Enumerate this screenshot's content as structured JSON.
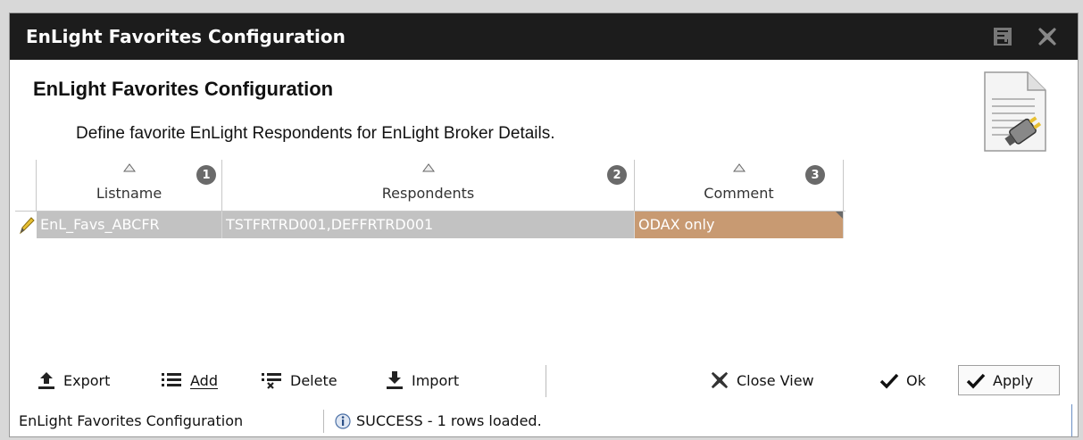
{
  "window": {
    "title": "EnLight Favorites Configuration"
  },
  "header": {
    "title": "EnLight Favorites Configuration",
    "description": "Define favorite EnLight Respondents for EnLight Broker Details."
  },
  "grid": {
    "columns": [
      {
        "label": "Listname",
        "order": "1"
      },
      {
        "label": "Respondents",
        "order": "2"
      },
      {
        "label": "Comment",
        "order": "3"
      }
    ],
    "rows": [
      {
        "listname": "EnL_Favs_ABCFR",
        "respondents": "TSTFRTRD001,DEFFRTRD001",
        "comment": "ODAX only"
      }
    ]
  },
  "toolbar": {
    "export_label": "Export",
    "add_label": "Add",
    "delete_label": "Delete",
    "import_label": "Import",
    "close_view_label": "Close View",
    "ok_label": "Ok",
    "apply_label": "Apply"
  },
  "status": {
    "view_name": "EnLight Favorites Configuration",
    "message": "SUCCESS - 1 rows loaded."
  },
  "colors": {
    "titlebar": "#1c1c1c",
    "row_selected": "#c2c2c2",
    "comment_highlight": "#c89a72"
  }
}
